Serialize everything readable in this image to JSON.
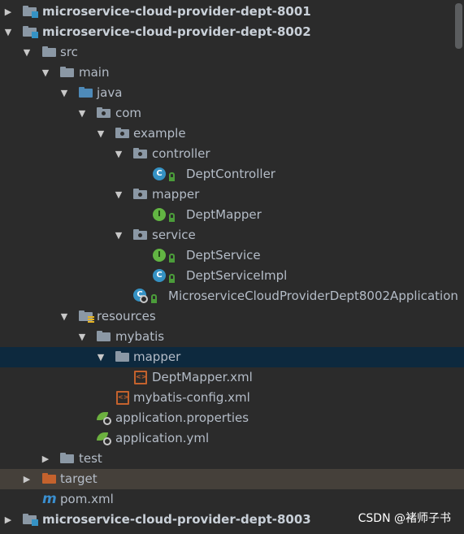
{
  "tree": {
    "module_8001": "microservice-cloud-provider-dept-8001",
    "module_8002": "microservice-cloud-provider-dept-8002",
    "src": "src",
    "main": "main",
    "java": "java",
    "com": "com",
    "example": "example",
    "controller": "controller",
    "dept_controller": "DeptController",
    "mapper": "mapper",
    "dept_mapper": "DeptMapper",
    "service": "service",
    "dept_service": "DeptService",
    "dept_service_impl": "DeptServiceImpl",
    "application_class": "MicroserviceCloudProviderDept8002Application",
    "resources": "resources",
    "mybatis": "mybatis",
    "mapper_folder": "mapper",
    "dept_mapper_xml": "DeptMapper.xml",
    "mybatis_config": "mybatis-config.xml",
    "application_properties": "application.properties",
    "application_yml": "application.yml",
    "test": "test",
    "target": "target",
    "pom": "pom.xml",
    "module_8003": "microservice-cloud-provider-dept-8003"
  },
  "glyphs": {
    "collapsed": "▶",
    "expanded": "▼",
    "class_letter": "C",
    "interface_letter": "I",
    "maven_letter": "m",
    "xml_letter": "<>"
  },
  "watermark": "CSDN @褚师子书",
  "colors": {
    "background": "#2b2b2b",
    "selected_row": "#0d293e",
    "excluded_row": "#45403a",
    "text": "#b4bcc7"
  }
}
